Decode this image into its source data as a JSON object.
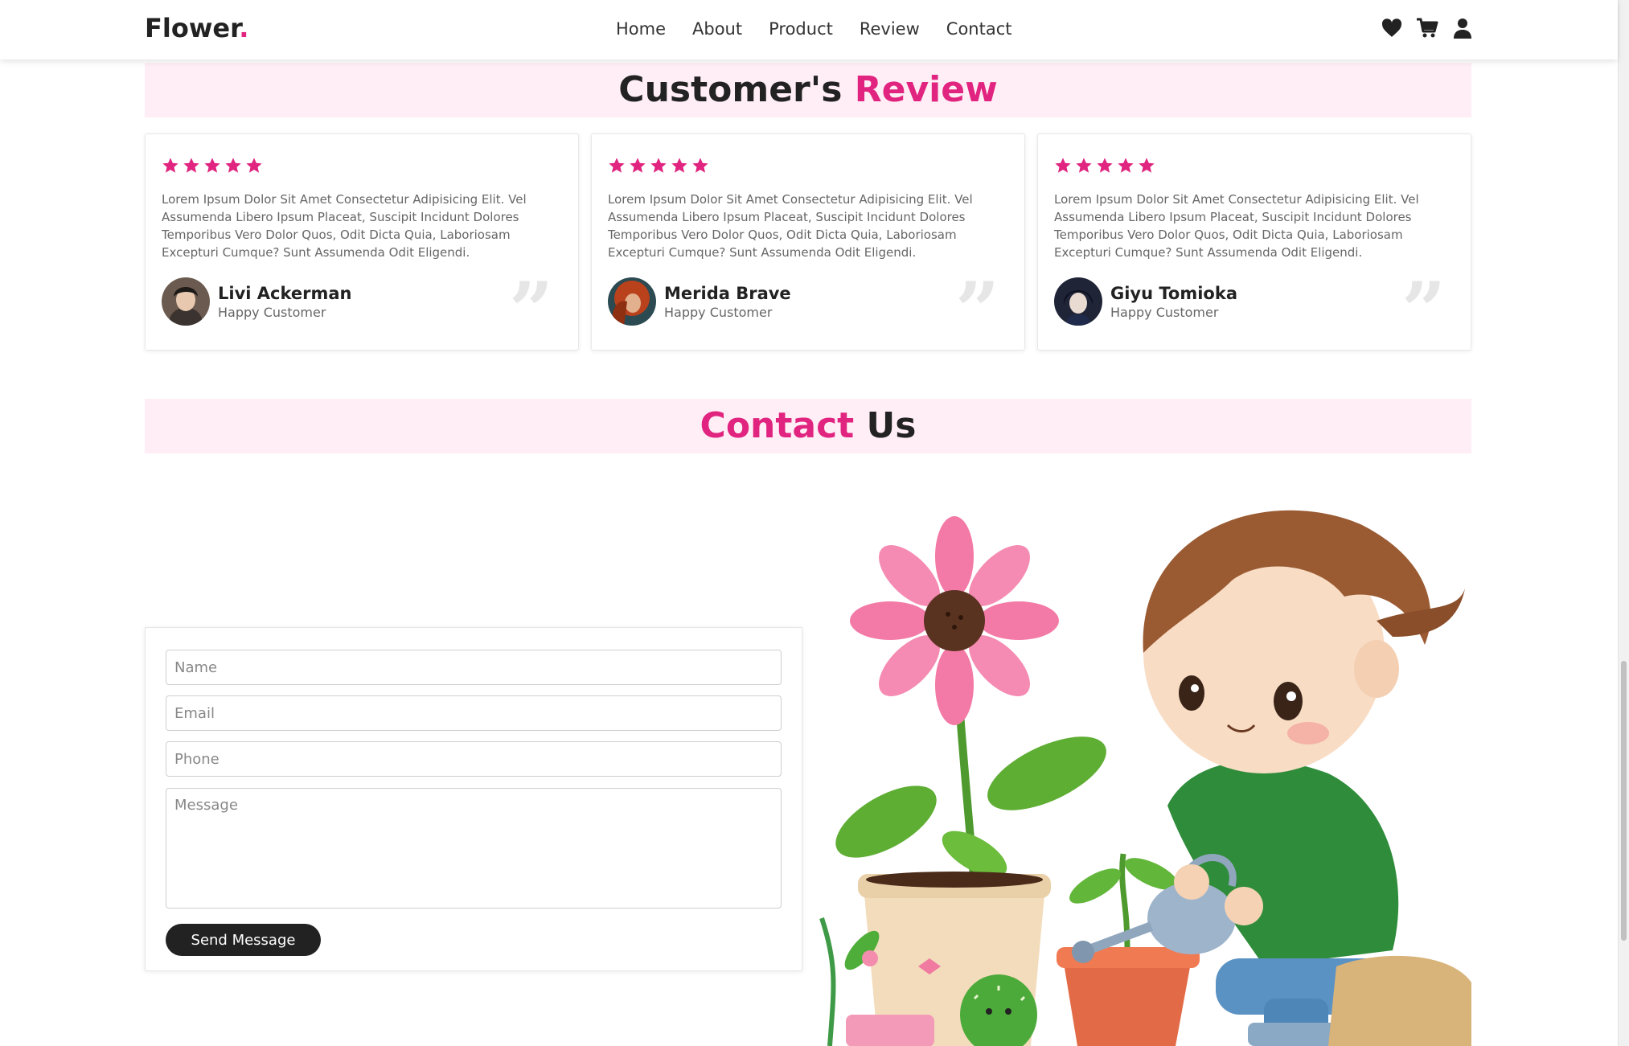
{
  "header": {
    "brand": "Flower",
    "brand_dot": ".",
    "nav": [
      "Home",
      "About",
      "Product",
      "Review",
      "Contact"
    ],
    "icons": [
      "heart-icon",
      "cart-icon",
      "user-icon"
    ]
  },
  "review_section": {
    "title_part1": "Customer's",
    "title_part2": "Review",
    "reviews": [
      {
        "rating": 5,
        "text": "Lorem Ipsum Dolor Sit Amet Consectetur Adipisicing Elit. Vel Assumenda Libero Ipsum Placeat, Suscipit Incidunt Dolores Temporibus Vero Dolor Quos, Odit Dicta Quia, Laboriosam Excepturi Cumque? Sunt Assumenda Odit Eligendi.",
        "name": "Livi Ackerman",
        "role": "Happy Customer"
      },
      {
        "rating": 5,
        "text": "Lorem Ipsum Dolor Sit Amet Consectetur Adipisicing Elit. Vel Assumenda Libero Ipsum Placeat, Suscipit Incidunt Dolores Temporibus Vero Dolor Quos, Odit Dicta Quia, Laboriosam Excepturi Cumque? Sunt Assumenda Odit Eligendi.",
        "name": "Merida Brave",
        "role": "Happy Customer"
      },
      {
        "rating": 5,
        "text": "Lorem Ipsum Dolor Sit Amet Consectetur Adipisicing Elit. Vel Assumenda Libero Ipsum Placeat, Suscipit Incidunt Dolores Temporibus Vero Dolor Quos, Odit Dicta Quia, Laboriosam Excepturi Cumque? Sunt Assumenda Odit Eligendi.",
        "name": "Giyu Tomioka",
        "role": "Happy Customer"
      }
    ]
  },
  "contact_section": {
    "title_part1": "Contact",
    "title_part2": "Us",
    "form": {
      "name_placeholder": "Name",
      "email_placeholder": "Email",
      "phone_placeholder": "Phone",
      "message_placeholder": "Message",
      "send_label": "Send Message"
    }
  },
  "colors": {
    "accent": "#e0247f",
    "title_bg": "#ffeef6",
    "dark": "#222222"
  }
}
